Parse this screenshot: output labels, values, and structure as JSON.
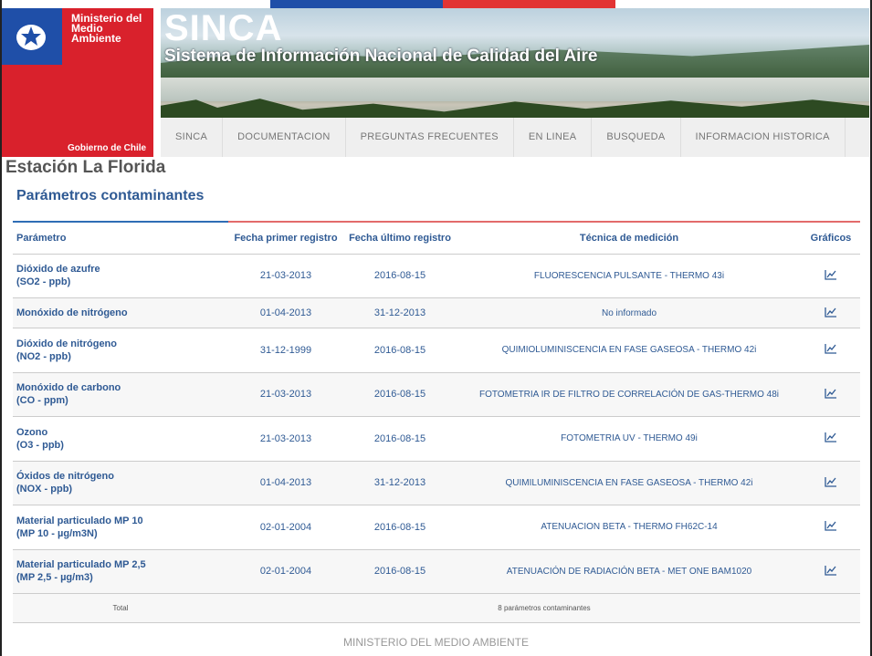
{
  "header": {
    "ministry_line1": "Ministerio del",
    "ministry_line2": "Medio",
    "ministry_line3": "Ambiente",
    "gobierno": "Gobierno de Chile",
    "title": "SINCA",
    "subtitle": "Sistema de Información Nacional de Calidad del Aire"
  },
  "nav": [
    {
      "label": "SINCA"
    },
    {
      "label": "DOCUMENTACION"
    },
    {
      "label": "PREGUNTAS FRECUENTES"
    },
    {
      "label": "EN LINEA"
    },
    {
      "label": "BUSQUEDA"
    },
    {
      "label": "INFORMACION HISTORICA"
    }
  ],
  "page": {
    "station": "Estación La Florida",
    "section": "Parámetros contaminantes"
  },
  "table": {
    "headers": {
      "parametro": "Parámetro",
      "primer": "Fecha primer registro",
      "ultimo": "Fecha último registro",
      "tecnica": "Técnica de medición",
      "graficos": "Gráficos"
    },
    "rows": [
      {
        "name": "Dióxido de azufre",
        "unit": "(SO2 - ppb)",
        "first": "21-03-2013",
        "last": "2016-08-15",
        "tech": "FLUORESCENCIA PULSANTE - THERMO 43i"
      },
      {
        "name": "Monóxido de nitrógeno",
        "unit": "",
        "first": "01-04-2013",
        "last": "31-12-2013",
        "tech": "No informado"
      },
      {
        "name": "Dióxido de nitrógeno",
        "unit": "(NO2 - ppb)",
        "first": "31-12-1999",
        "last": "2016-08-15",
        "tech": "QUIMIOLUMINISCENCIA EN FASE GASEOSA - THERMO 42i"
      },
      {
        "name": "Monóxido de carbono",
        "unit": "(CO - ppm)",
        "first": "21-03-2013",
        "last": "2016-08-15",
        "tech": "FOTOMETRIA IR DE FILTRO DE CORRELACIÓN DE GAS-THERMO 48i"
      },
      {
        "name": "Ozono",
        "unit": "(O3 - ppb)",
        "first": "21-03-2013",
        "last": "2016-08-15",
        "tech": "FOTOMETRIA UV - THERMO 49i"
      },
      {
        "name": "Óxidos de nitrógeno",
        "unit": "(NOX - ppb)",
        "first": "01-04-2013",
        "last": "31-12-2013",
        "tech": "QUIMILUMINISCENCIA EN FASE GASEOSA - THERMO 42i"
      },
      {
        "name": "Material particulado MP 10",
        "unit": "(MP 10 - µg/m3N)",
        "first": "02-01-2004",
        "last": "2016-08-15",
        "tech": "ATENUACION BETA - THERMO FH62C-14"
      },
      {
        "name": "Material particulado MP 2,5",
        "unit": "(MP 2,5 - µg/m3)",
        "first": "02-01-2004",
        "last": "2016-08-15",
        "tech": "ATENUACIÓN DE RADIACIÓN BETA - MET ONE BAM1020"
      }
    ],
    "total_label": "Total",
    "total_value": "8 parámetros contaminantes"
  },
  "footer": "MINISTERIO DEL MEDIO AMBIENTE",
  "colors": {
    "accent_blue": "#2f5a94",
    "brand_red": "#d9212c",
    "brand_blue": "#1f4fa8"
  }
}
